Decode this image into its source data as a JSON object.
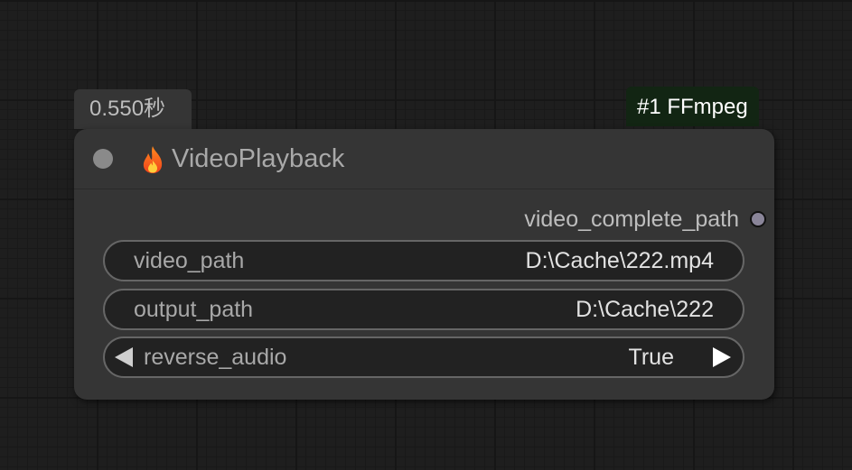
{
  "execution_time": "0.550秒",
  "node_badge": "#1 FFmpeg",
  "node": {
    "title": "VideoPlayback",
    "title_icon": "fire-icon",
    "output": {
      "label": "video_complete_path"
    },
    "widgets": [
      {
        "label": "video_path",
        "value": "D:\\Cache\\222.mp4"
      },
      {
        "label": "output_path",
        "value": "D:\\Cache\\222"
      },
      {
        "label": "reverse_audio",
        "value": "True"
      }
    ]
  },
  "colors": {
    "canvas_bg": "#1e1e1e",
    "node_bg": "#353535",
    "badge_bg": "#122513",
    "output_slot": "#8a8599",
    "widget_border": "#666666"
  }
}
